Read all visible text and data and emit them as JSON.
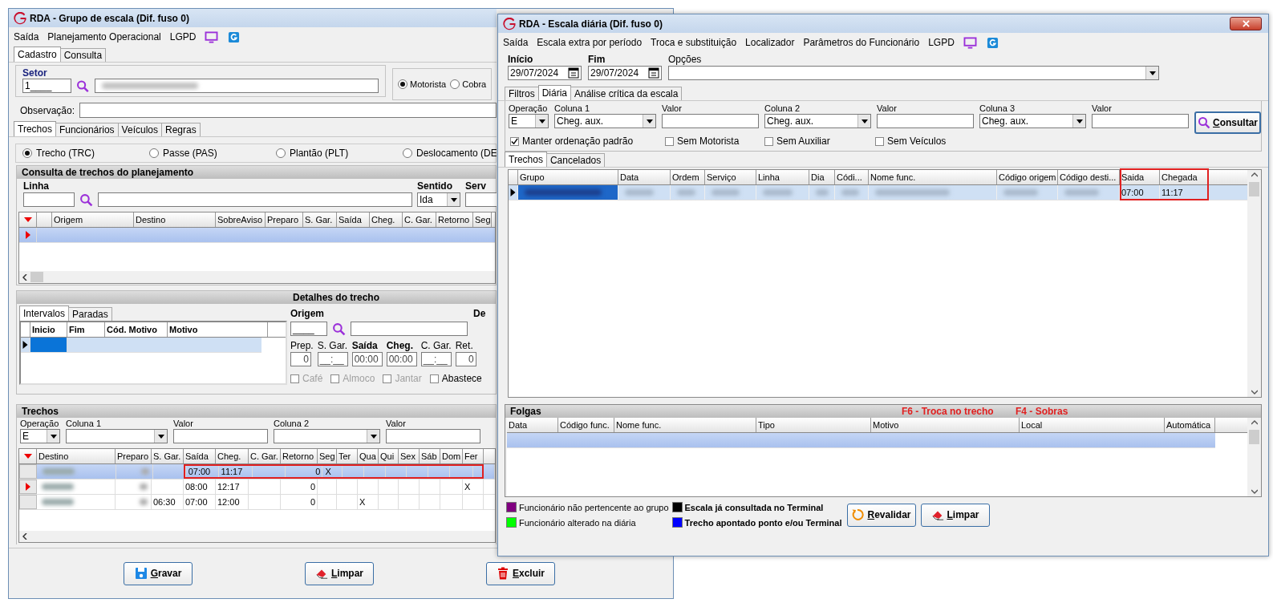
{
  "left_window": {
    "title": "RDA - Grupo de escala (Dif. fuso 0)",
    "menu": [
      "Saída",
      "Planejamento Operacional",
      "LGPD"
    ],
    "tabs": [
      {
        "label": "Cadastro",
        "selected": true
      },
      {
        "label": "Consulta",
        "selected": false
      }
    ],
    "setor": {
      "label": "Setor",
      "value": "1____"
    },
    "role_options": [
      {
        "label": "Motorista",
        "selected": true
      },
      {
        "label": "Cobra",
        "selected": false
      }
    ],
    "observacao_label": "Observação:",
    "sub_tabs": [
      {
        "label": "Trechos",
        "selected": true
      },
      {
        "label": "Funcionários",
        "selected": false
      },
      {
        "label": "Veículos",
        "selected": false
      },
      {
        "label": "Regras",
        "selected": false
      }
    ],
    "type_options": [
      {
        "label": "Trecho (TRC)",
        "selected": true
      },
      {
        "label": "Passe (PAS)",
        "selected": false
      },
      {
        "label": "Plantão (PLT)",
        "selected": false
      },
      {
        "label": "Deslocamento (DE",
        "selected": false
      }
    ],
    "plan_panel": {
      "title": "Consulta de trechos do planejamento",
      "linha_label": "Linha",
      "sentido_label": "Sentido",
      "sentido_value": "Ida",
      "column_4_label": "Serv",
      "columns": [
        "Origem",
        "Destino",
        "SobreAviso",
        "Preparo",
        "S. Gar.",
        "Saída",
        "Cheg.",
        "C. Gar.",
        "Retorno",
        "Seg"
      ],
      "rows": [
        {
          "selected": true,
          "current": true
        }
      ]
    },
    "details_panel": {
      "title": "Detalhes do trecho",
      "tabs": [
        {
          "label": "Intervalos",
          "selected": true
        },
        {
          "label": "Paradas",
          "selected": false
        }
      ],
      "columns": [
        "Inicio",
        "Fim",
        "Cód. Motivo",
        "Motivo"
      ],
      "rows": [
        {
          "selected": true,
          "current": true
        }
      ],
      "origem_label": "Origem",
      "origem_value": "____",
      "destino_label": "De",
      "fields": [
        {
          "label": "Prep.",
          "value": "0",
          "bold": false
        },
        {
          "label": "S. Gar.",
          "value": "__:__",
          "bold": false
        },
        {
          "label": "Saída",
          "value": "00:00",
          "bold": true
        },
        {
          "label": "Cheg.",
          "value": "00:00",
          "bold": true
        },
        {
          "label": "C. Gar.",
          "value": "__:__",
          "bold": false
        },
        {
          "label": "Ret.",
          "value": "0",
          "bold": false
        }
      ],
      "checks": [
        {
          "label": "Café",
          "checked": false,
          "disabled": true
        },
        {
          "label": "Almoco",
          "checked": false,
          "disabled": true
        },
        {
          "label": "Jantar",
          "checked": false,
          "disabled": true
        },
        {
          "label": "Abastece",
          "checked": false,
          "disabled": false
        }
      ]
    },
    "trechos_panel": {
      "title": "Trechos",
      "filter_labels": [
        "Operação",
        "Coluna 1",
        "Valor",
        "Coluna 2",
        "Valor"
      ],
      "operacao_value": "E",
      "columns": [
        "Destino",
        "Preparo",
        "S. Gar.",
        "Saída",
        "Cheg.",
        "C. Gar.",
        "Retorno",
        "Seg",
        "Ter",
        "Qua",
        "Qui",
        "Sex",
        "Sáb",
        "Dom",
        "Fer"
      ],
      "rows": [
        {
          "selected": true,
          "current": false,
          "highlighted": true,
          "cells": [
            null,
            null,
            null,
            "07:00",
            "11:17",
            null,
            "0",
            "X",
            null,
            null,
            null,
            null,
            null,
            null,
            null
          ]
        },
        {
          "selected": false,
          "current": true,
          "highlighted": false,
          "cells": [
            null,
            null,
            null,
            "08:00",
            "12:17",
            null,
            "0",
            null,
            null,
            null,
            null,
            null,
            null,
            null,
            "X"
          ]
        },
        {
          "selected": false,
          "current": false,
          "highlighted": false,
          "cells": [
            null,
            null,
            "06:30",
            "07:00",
            "12:00",
            null,
            "0",
            null,
            null,
            "X",
            null,
            null,
            null,
            null,
            null
          ]
        }
      ]
    },
    "buttons": [
      {
        "label": "Gravar",
        "kind": "save"
      },
      {
        "label": "Limpar",
        "kind": "clear"
      },
      {
        "label": "Excluir",
        "kind": "delete"
      }
    ]
  },
  "right_window": {
    "title": "RDA - Escala diária (Dif. fuso 0)",
    "menu": [
      "Saída",
      "Escala extra por período",
      "Troca e substituição",
      "Localizador",
      "Parâmetros do Funcionário",
      "LGPD"
    ],
    "inicio": {
      "label": "Início",
      "value": "29/07/2024"
    },
    "fim": {
      "label": "Fim",
      "value": "29/07/2024"
    },
    "opcoes_label": "Opções",
    "tabs": [
      {
        "label": "Filtros",
        "selected": false
      },
      {
        "label": "Diária",
        "selected": true
      },
      {
        "label": "Análise crítica da escala",
        "selected": false
      }
    ],
    "filters": [
      {
        "label": "Operação",
        "kind": "select",
        "value": "E"
      },
      {
        "label": "Coluna 1",
        "kind": "select",
        "value": "Cheg. aux."
      },
      {
        "label": "Valor",
        "kind": "text"
      },
      {
        "label": "Coluna 2",
        "kind": "select",
        "value": "Cheg. aux."
      },
      {
        "label": "Valor",
        "kind": "text"
      },
      {
        "label": "Coluna 3",
        "kind": "select",
        "value": "Cheg. aux."
      },
      {
        "label": "Valor",
        "kind": "text"
      }
    ],
    "consult_button": "Consultar",
    "checks": [
      {
        "label": "Manter ordenação padrão",
        "checked": true
      },
      {
        "label": "Sem Motorista",
        "checked": false
      },
      {
        "label": "Sem Auxiliar",
        "checked": false
      },
      {
        "label": "Sem Veículos",
        "checked": false
      }
    ],
    "grid_tabs": [
      {
        "label": "Trechos",
        "selected": true
      },
      {
        "label": "Cancelados",
        "selected": false
      }
    ],
    "columns": [
      {
        "label": "Grupo",
        "highlighted": false
      },
      {
        "label": "Data",
        "highlighted": false
      },
      {
        "label": "Ordem",
        "highlighted": false
      },
      {
        "label": "Serviço",
        "highlighted": false
      },
      {
        "label": "Linha",
        "highlighted": false
      },
      {
        "label": "Dia",
        "highlighted": false
      },
      {
        "label": "Códi...",
        "highlighted": false
      },
      {
        "label": "Nome func.",
        "highlighted": false
      },
      {
        "label": "Código origem",
        "highlighted": false
      },
      {
        "label": "Código desti...",
        "highlighted": false
      },
      {
        "label": "Saida",
        "highlighted": true
      },
      {
        "label": "Chegada",
        "highlighted": true
      }
    ],
    "rows": [
      {
        "selected": true,
        "current": true,
        "cells": [
          null,
          null,
          null,
          null,
          null,
          null,
          null,
          null,
          null,
          null,
          "07:00",
          "11:17"
        ]
      }
    ],
    "folgas": {
      "title": "Folgas",
      "hotkeys": [
        "F6 - Troca no trecho",
        "F4 - Sobras"
      ],
      "columns": [
        "Data",
        "Código func.",
        "Nome func.",
        "Tipo",
        "Motivo",
        "Local",
        "Automática"
      ],
      "rows": [
        {
          "selected": true
        }
      ]
    },
    "legend": [
      {
        "label": "Funcionário não pertencente ao grupo",
        "color": "#800080",
        "bold": false
      },
      {
        "label": "Funcionário alterado na diária",
        "color": "#00ff00",
        "bold": false
      },
      {
        "label": "Escala já consultada no Terminal",
        "color": "#000000",
        "bold": true
      },
      {
        "label": "Trecho apontado ponto e/ou Terminal",
        "color": "#0000ff",
        "bold": true
      }
    ],
    "buttons": [
      {
        "label": "Revalidar",
        "kind": "refresh"
      },
      {
        "label": "Limpar",
        "kind": "clear"
      }
    ]
  }
}
